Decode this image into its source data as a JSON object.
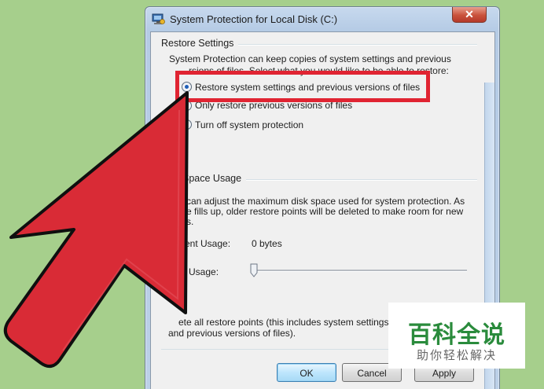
{
  "window": {
    "title": "System Protection for Local Disk (C:)",
    "close_glyph": "✕",
    "icon": "system-protection-icon"
  },
  "restore_settings": {
    "group_label": "Restore Settings",
    "description_line1": "System Protection can keep copies of system settings and previous",
    "description_line2": "rsions of files. Select what you would like to be able to restore:",
    "options": [
      {
        "label": "Restore system settings and previous versions of files",
        "selected": true
      },
      {
        "label": "Only restore previous versions of files",
        "selected": false
      },
      {
        "label": "Turn off system protection",
        "selected": false
      }
    ]
  },
  "disk_space": {
    "group_label": "Space Usage",
    "description_line1": "can adjust the maximum disk space used for system protection. As",
    "description_line2": "e fills up, older restore points will be deleted to make room for new",
    "description_line3": "s.",
    "current_usage_label": "ent Usage:",
    "current_usage_value": "0 bytes",
    "max_usage_label": "Usage:",
    "max_usage_level": 0
  },
  "delete": {
    "description_line1": "ete all restore points (this includes system settings",
    "description_line2": "and previous versions of files)."
  },
  "buttons": {
    "ok": "OK",
    "cancel": "Cancel",
    "apply": "Apply"
  },
  "watermark": {
    "title": "百科全说",
    "subtitle": "助你轻松解决"
  },
  "colors": {
    "background": "#a6cf8c",
    "highlight": "#e02432",
    "arrow": "#d92b36",
    "watermark_green": "#2a8b3c"
  }
}
